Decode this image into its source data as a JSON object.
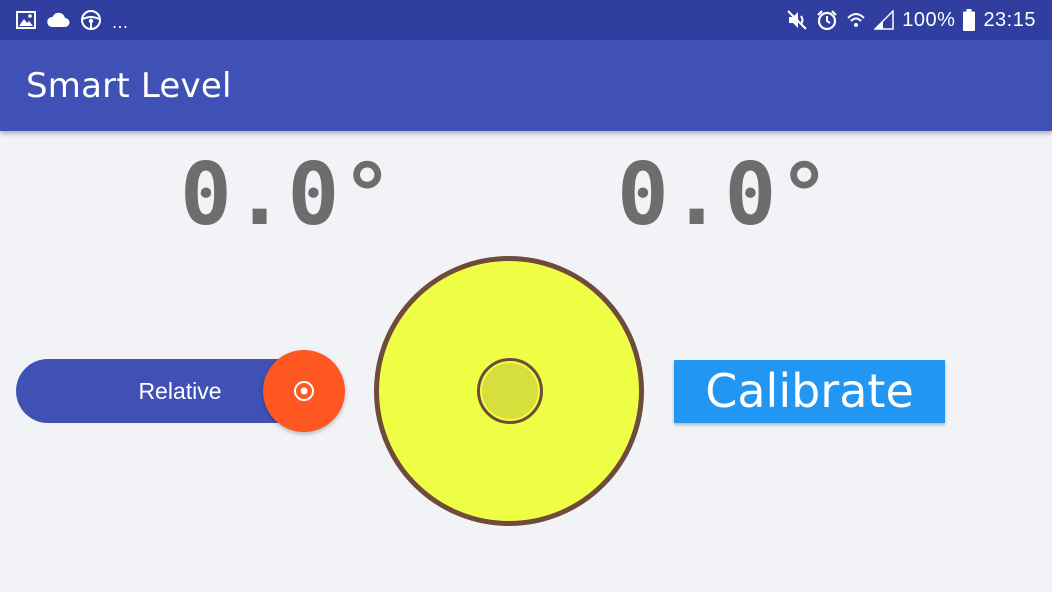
{
  "status_bar": {
    "overflow": "...",
    "battery_text": "100%",
    "time": "23:15",
    "left_icons": [
      "image-icon",
      "cloud-icon",
      "steering-wheel-icon"
    ],
    "right_icons": [
      "mute-icon",
      "alarm-icon",
      "wifi-icon",
      "signal-icon",
      "battery-icon"
    ]
  },
  "app_bar": {
    "title": "Smart Level"
  },
  "readouts": {
    "x_angle": "0.0°",
    "y_angle": "0.0°"
  },
  "relative_toggle": {
    "label": "Relative",
    "icon": "target-icon"
  },
  "calibrate_button": {
    "label": "Calibrate"
  },
  "colors": {
    "status_bar": "#303f9f",
    "app_bar": "#3f51b5",
    "toggle_knob": "#ff5722",
    "level_fill": "#eefe44",
    "level_border": "#6e4b3a",
    "calibrate": "#2196f3",
    "readout_text": "#6d6d6d"
  }
}
